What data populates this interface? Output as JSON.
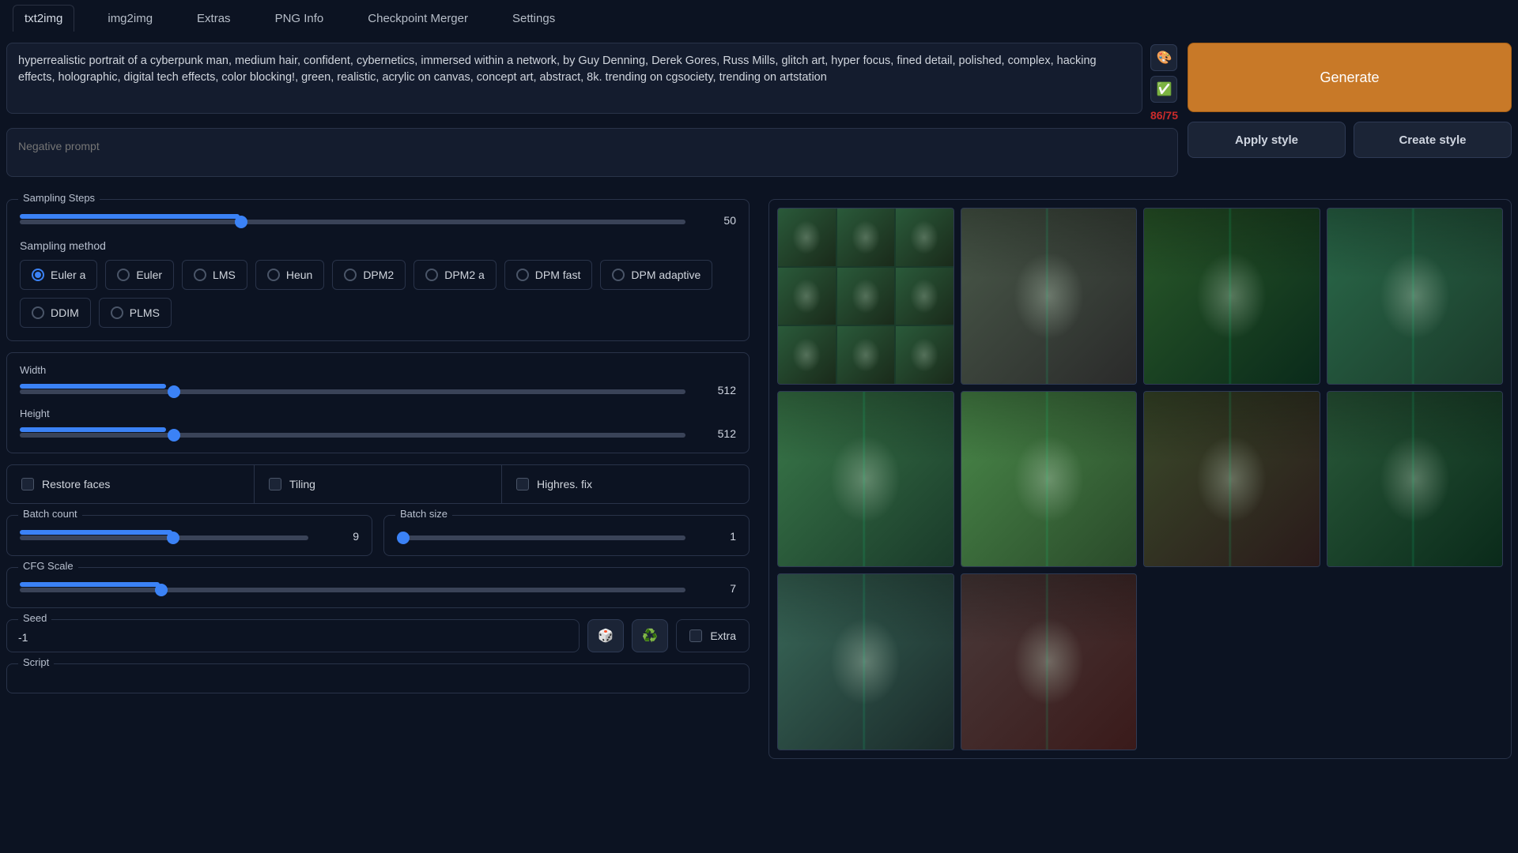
{
  "tabs": [
    "txt2img",
    "img2img",
    "Extras",
    "PNG Info",
    "Checkpoint Merger",
    "Settings"
  ],
  "active_tab": 0,
  "prompt": "hyperrealistic portrait of a cyberpunk man, medium hair, confident, cybernetics, immersed within a network, by Guy Denning, Derek Gores, Russ Mills, glitch art, hyper focus, fined detail, polished, complex, hacking effects, holographic, digital tech effects, color blocking!, green, realistic, acrylic on canvas, concept art, abstract, 8k. trending on cgsociety, trending on artstation",
  "neg_prompt_placeholder": "Negative prompt",
  "token_count": "86/75",
  "icons": {
    "palette": "🎨",
    "check": "✅",
    "dice": "🎲",
    "recycle": "♻️"
  },
  "buttons": {
    "generate": "Generate",
    "apply_style": "Apply style",
    "create_style": "Create style"
  },
  "sampling_steps": {
    "label": "Sampling Steps",
    "value": 50,
    "max": 150
  },
  "sampling_method": {
    "label": "Sampling method",
    "options": [
      "Euler a",
      "Euler",
      "LMS",
      "Heun",
      "DPM2",
      "DPM2 a",
      "DPM fast",
      "DPM adaptive",
      "DDIM",
      "PLMS"
    ],
    "selected": 0
  },
  "width": {
    "label": "Width",
    "value": 512,
    "max": 2048
  },
  "height": {
    "label": "Height",
    "value": 512,
    "max": 2048
  },
  "checks": {
    "restore_faces": "Restore faces",
    "tiling": "Tiling",
    "highres": "Highres. fix"
  },
  "batch_count": {
    "label": "Batch count",
    "value": 9,
    "max": 16
  },
  "batch_size": {
    "label": "Batch size",
    "value": 1,
    "max": 8
  },
  "cfg": {
    "label": "CFG Scale",
    "value": 7,
    "max": 30
  },
  "seed": {
    "label": "Seed",
    "value": "-1",
    "extra_label": "Extra"
  },
  "script": {
    "label": "Script"
  },
  "gallery": {
    "tints": [
      [
        "#3a6b3a",
        "#1a2a1a"
      ],
      [
        "#4a5a4a",
        "#2a2a2a"
      ],
      [
        "#2a5a2a",
        "#0a2a1a"
      ],
      [
        "#2a6a4a",
        "#1a3a2a"
      ],
      [
        "#3a7a4a",
        "#1a3a2a"
      ],
      [
        "#4a8a4a",
        "#2a4a2a"
      ],
      [
        "#3a4a2a",
        "#2a1a1a"
      ],
      [
        "#2a5a3a",
        "#0a2a1a"
      ],
      [
        "#3a6a5a",
        "#1a2a2a"
      ],
      [
        "#4a3a3a",
        "#3a1a1a"
      ]
    ]
  }
}
